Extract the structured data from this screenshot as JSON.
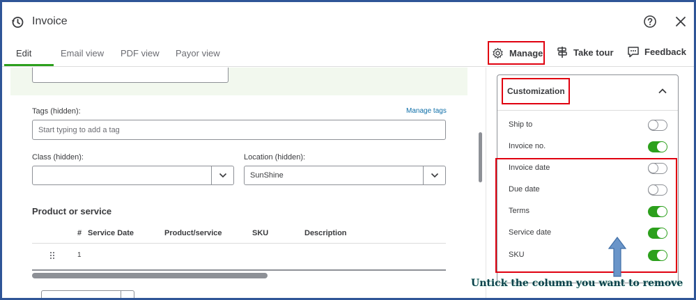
{
  "header": {
    "title": "Invoice",
    "icons": {
      "history": "history-icon",
      "help": "help-icon",
      "close": "close-icon"
    }
  },
  "tabs": [
    {
      "label": "Edit",
      "active": true
    },
    {
      "label": "Email view",
      "active": false
    },
    {
      "label": "PDF view",
      "active": false
    },
    {
      "label": "Payor view",
      "active": false
    }
  ],
  "toolbar": {
    "manage_label": "Manage",
    "tour_label": "Take tour",
    "feedback_label": "Feedback"
  },
  "form": {
    "tags_label": "Tags (hidden):",
    "manage_tags_label": "Manage tags",
    "tags_placeholder": "Start typing to add a tag",
    "class_label": "Class (hidden):",
    "class_value": "",
    "location_label": "Location (hidden):",
    "location_value": "SunShine",
    "section_title": "Product or service",
    "table_headers": [
      "#",
      "Service Date",
      "Product/service",
      "SKU",
      "Description"
    ],
    "rows": [
      {
        "num": "1"
      }
    ]
  },
  "customization": {
    "title": "Customization",
    "options": [
      {
        "label": "Ship to",
        "on": false
      },
      {
        "label": "Invoice no.",
        "on": true
      },
      {
        "label": "Invoice date",
        "on": false
      },
      {
        "label": "Due date",
        "on": false
      },
      {
        "label": "Terms",
        "on": true
      },
      {
        "label": "Service date",
        "on": true
      },
      {
        "label": "SKU",
        "on": true
      }
    ]
  },
  "annotation": "Untick the column you want to remove",
  "colors": {
    "accent_green": "#2ca01c",
    "highlight_red": "#e0000f",
    "link_blue": "#0d6ea8",
    "frame_blue": "#2f5597"
  }
}
